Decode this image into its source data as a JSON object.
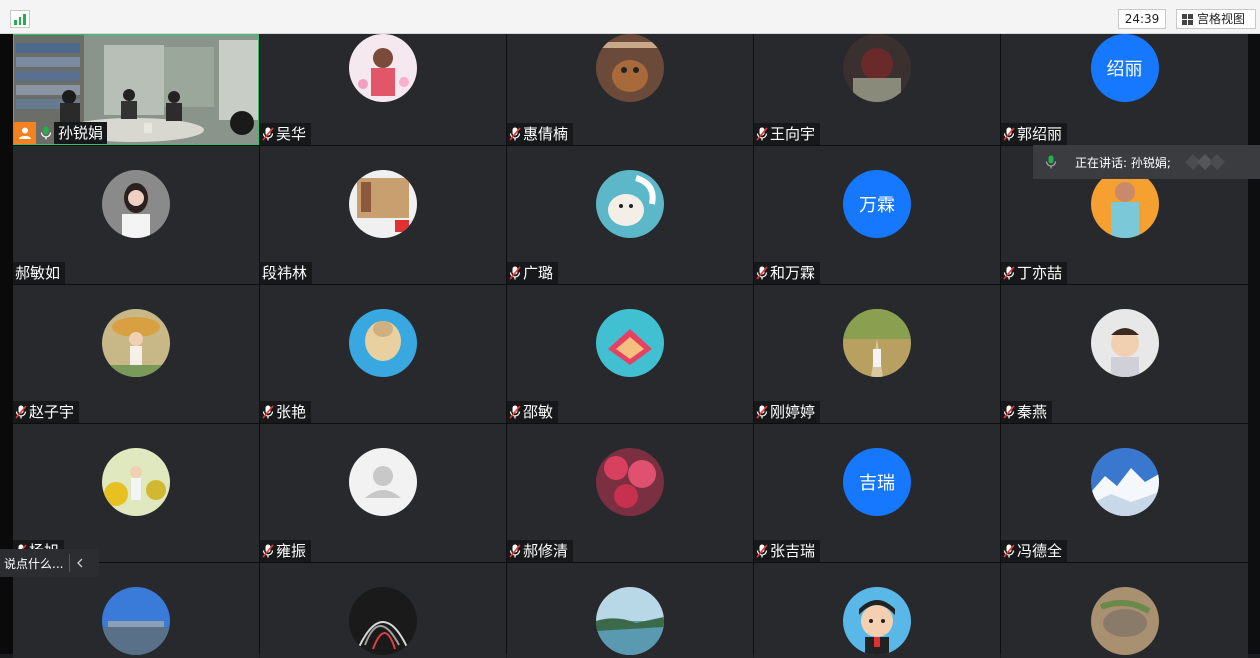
{
  "toolbar": {
    "timer": "24:39",
    "grid_view_label": "宫格视图"
  },
  "self_name": "孙锐娟",
  "speaking_label": "正在讲话: 孙锐娟;",
  "chat_placeholder": "说点什么...",
  "participants": [
    {
      "name": "吴华"
    },
    {
      "name": "惠倩楠"
    },
    {
      "name": "王向宇"
    },
    {
      "name": "郭绍丽",
      "avatar_text": "绍丽"
    },
    {
      "name": "郝敏如"
    },
    {
      "name": "段祎林"
    },
    {
      "name": "广璐"
    },
    {
      "name": "和万霖",
      "avatar_text": "万霖"
    },
    {
      "name": "丁亦喆"
    },
    {
      "name": "赵子宇"
    },
    {
      "name": "张艳"
    },
    {
      "name": "邵敏"
    },
    {
      "name": "刚婷婷"
    },
    {
      "name": "秦燕"
    },
    {
      "name": "杨旭"
    },
    {
      "name": "雍振"
    },
    {
      "name": "郝修清"
    },
    {
      "name": "张吉瑞",
      "avatar_text": "吉瑞"
    },
    {
      "name": "冯德全"
    }
  ],
  "colors": {
    "accent": "#1677ff",
    "mic_green": "#23b14d",
    "self_badge": "#f58220",
    "tile_bg": "#27292d"
  }
}
